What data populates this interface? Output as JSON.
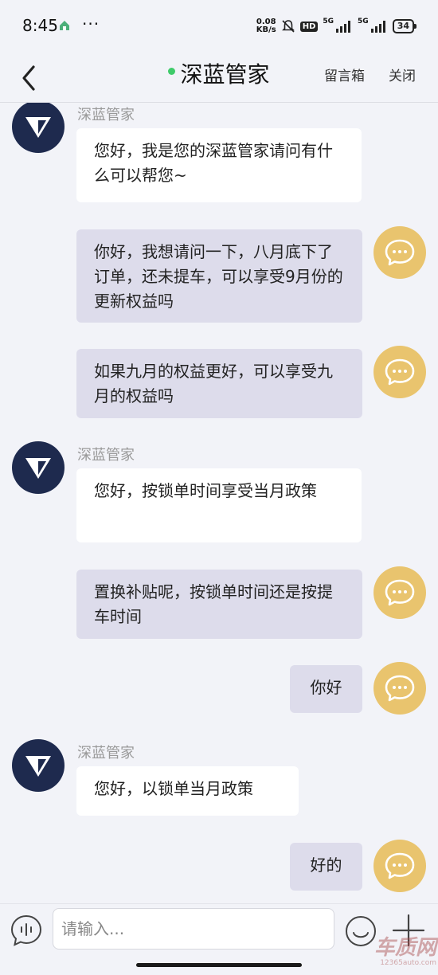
{
  "status": {
    "time": "8:45",
    "dots": "···",
    "net_speed_value": "0.08",
    "net_speed_unit": "KB/s",
    "hd": "HD",
    "signal_1": "5G",
    "signal_2": "5G",
    "battery": "34"
  },
  "header": {
    "title": "深蓝管家",
    "message_box": "留言箱",
    "close": "关闭",
    "online_color": "#3fcb6a"
  },
  "messages": [
    {
      "sender": "agent",
      "name": "深蓝管家",
      "text": "您好，我是您的深蓝管家请问有什么可以帮您~"
    },
    {
      "sender": "user",
      "text": "你好，我想请问一下，八月底下了订单，还未提车，可以享受9月份的更新权益吗"
    },
    {
      "sender": "user",
      "text": "如果九月的权益更好，可以享受九月的权益吗"
    },
    {
      "sender": "agent",
      "name": "深蓝管家",
      "text": "您好，按锁单时间享受当月政策"
    },
    {
      "sender": "user",
      "text": "置换补贴呢，按锁单时间还是按提车时间"
    },
    {
      "sender": "user",
      "text": "你好"
    },
    {
      "sender": "agent",
      "name": "深蓝管家",
      "text": "您好，以锁单当月政策"
    },
    {
      "sender": "user",
      "text": "好的"
    }
  ],
  "input": {
    "placeholder": "请输入..."
  },
  "watermark": {
    "main": "车质网",
    "sub": "12365auto.com"
  },
  "colors": {
    "agent_avatar": "#1e2a4e",
    "user_avatar": "#e9c46e",
    "agent_bubble": "#ffffff",
    "user_bubble": "#dddceb"
  }
}
